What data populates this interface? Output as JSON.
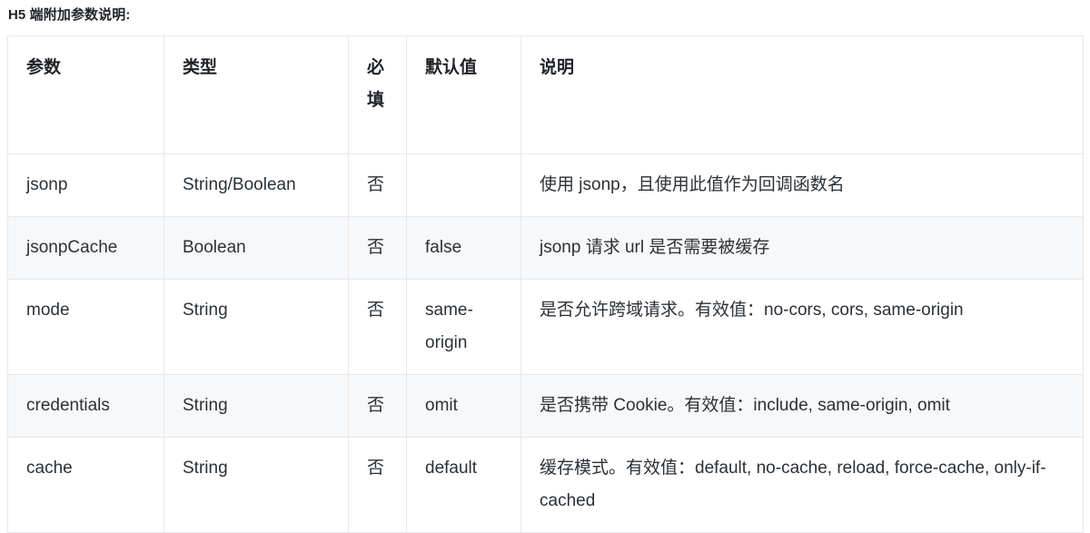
{
  "section": {
    "title": "H5 端附加参数说明:"
  },
  "table": {
    "columns": [
      {
        "key": "param",
        "label": "参数"
      },
      {
        "key": "type",
        "label": "类型"
      },
      {
        "key": "required",
        "label": "必填"
      },
      {
        "key": "default",
        "label": "默认值"
      },
      {
        "key": "desc",
        "label": "说明"
      }
    ],
    "rows": [
      {
        "param": "jsonp",
        "type": "String/Boolean",
        "required": "否",
        "default": "",
        "desc": "使用 jsonp，且使用此值作为回调函数名",
        "striped": false
      },
      {
        "param": "jsonpCache",
        "type": "Boolean",
        "required": "否",
        "default": "false",
        "desc": "jsonp 请求 url 是否需要被缓存",
        "striped": true
      },
      {
        "param": "mode",
        "type": "String",
        "required": "否",
        "default": "same-origin",
        "desc": "是否允许跨域请求。有效值：no-cors, cors, same-origin",
        "striped": false
      },
      {
        "param": "credentials",
        "type": "String",
        "required": "否",
        "default": "omit",
        "desc": "是否携带 Cookie。有效值：include, same-origin, omit",
        "striped": true
      },
      {
        "param": "cache",
        "type": "String",
        "required": "否",
        "default": "default",
        "desc": "缓存模式。有效值：default, no-cache, reload, force-cache, only-if-cached",
        "striped": false
      }
    ]
  },
  "colors": {
    "text": "#24292f",
    "heading": "#1f2328",
    "border": "#e6e8eb",
    "stripe": "#f7f8f9",
    "background": "#ffffff"
  }
}
